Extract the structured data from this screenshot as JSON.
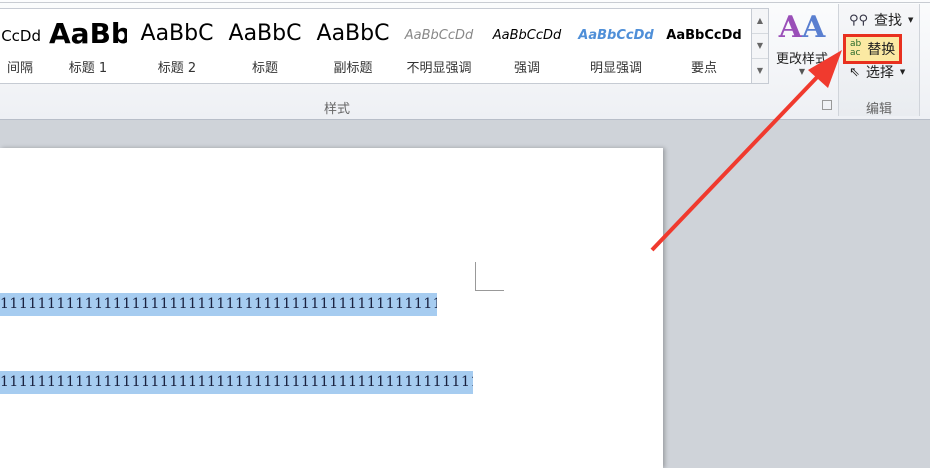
{
  "styles": [
    {
      "preview": "CcDd",
      "label": "间隔"
    },
    {
      "preview": "AaBb",
      "label": "标题 1"
    },
    {
      "preview": "AaBbC",
      "label": "标题 2"
    },
    {
      "preview": "AaBbC",
      "label": "标题"
    },
    {
      "preview": "AaBbC",
      "label": "副标题"
    },
    {
      "preview": "AaBbCcDd",
      "label": "不明显强调"
    },
    {
      "preview": "AaBbCcDd",
      "label": "强调"
    },
    {
      "preview": "AaBbCcDd",
      "label": "明显强调"
    },
    {
      "preview": "AaBbCcDd",
      "label": "要点"
    }
  ],
  "styles_group": "样式",
  "change_styles": "更改样式",
  "editing": {
    "find": "查找",
    "replace": "替换",
    "select": "选择",
    "group": "编辑"
  },
  "document": {
    "line1": "1111111111111111111111111111111111111111111111111↵",
    "line2": "1111111111111111111111111111111111111111111111111111111"
  },
  "colors": {
    "highlight": "#a6ccf0",
    "arrow": "#f03a2e"
  }
}
